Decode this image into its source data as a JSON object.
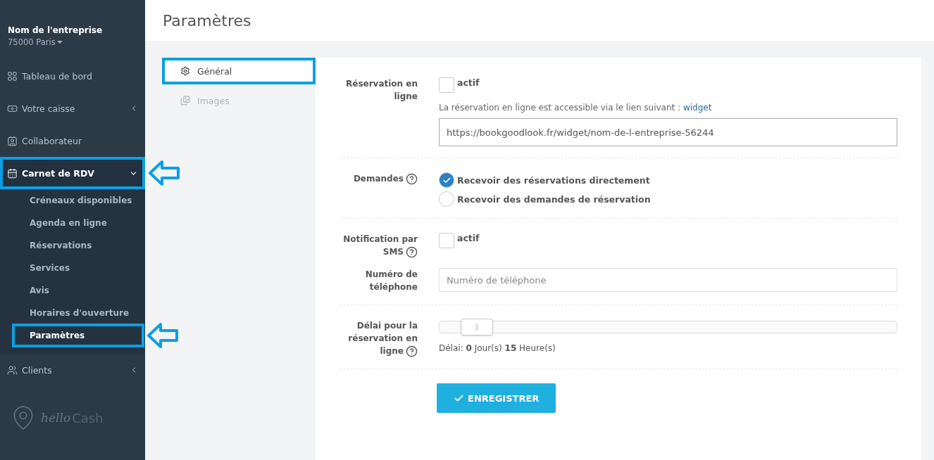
{
  "company": {
    "name": "Nom de l'entreprise",
    "city": "75000 Paris"
  },
  "sidebar": {
    "items": [
      {
        "label": "Tableau de bord",
        "selected": false
      },
      {
        "label": "Votre caisse",
        "selected": false,
        "expanded": false
      },
      {
        "label": "Collaborateur",
        "selected": false
      },
      {
        "label": "Carnet de RDV",
        "selected": true,
        "expanded": true,
        "highlighted": true,
        "arrow": true,
        "children": [
          {
            "label": "Créneaux disponibles",
            "selected": false
          },
          {
            "label": "Agenda en ligne",
            "selected": false
          },
          {
            "label": "Réservations",
            "selected": false
          },
          {
            "label": "Services",
            "selected": false
          },
          {
            "label": "Avis",
            "selected": false
          },
          {
            "label": "Horaires d'ouverture",
            "selected": false
          },
          {
            "label": "Paramètres",
            "selected": true,
            "highlighted": true,
            "arrow": true
          }
        ]
      },
      {
        "label": "Clients",
        "selected": false,
        "expanded": false
      }
    ],
    "logo": {
      "part_1": "hello",
      "part_2": "Cash"
    }
  },
  "page_title": "Paramètres",
  "tabs": [
    {
      "label": "Général",
      "selected": true,
      "highlighted": true
    },
    {
      "label": "Images",
      "selected": false
    }
  ],
  "sections": [
    {
      "rows": [
        {
          "kind": "online",
          "label": "Réservation en ligne",
          "help": false,
          "checkbox": {
            "label": "actif",
            "checked": false
          },
          "note": "La réservation en ligne est accessible via le lien suivant : ",
          "link": "widget",
          "value": "https://bookgoodlook.fr/widget/nom-de-l-entreprise-56244"
        }
      ]
    },
    {
      "rows": [
        {
          "kind": "radio",
          "label": "Demandes",
          "help": true,
          "options": [
            {
              "label": "Recevoir des réservations directement",
              "selected": true
            },
            {
              "label": "Recevoir des demandes de réservation",
              "selected": false
            }
          ]
        }
      ]
    },
    {
      "rows": [
        {
          "kind": "checkbox",
          "label": "Notification par SMS",
          "help": true,
          "checkbox": {
            "label": "actif",
            "checked": false
          }
        },
        {
          "kind": "input",
          "label": "Numéro de téléphone",
          "help": false,
          "placeholder": "Numéro de téléphone"
        }
      ]
    },
    {
      "rows": [
        {
          "kind": "slider",
          "label": "Délai pour la réservation en ligne",
          "help": true,
          "level": 0.05,
          "reading": "Délai: **0** Jour(s) **15** Heure(s)"
        }
      ]
    }
  ],
  "save_button": "ENREGISTRER"
}
